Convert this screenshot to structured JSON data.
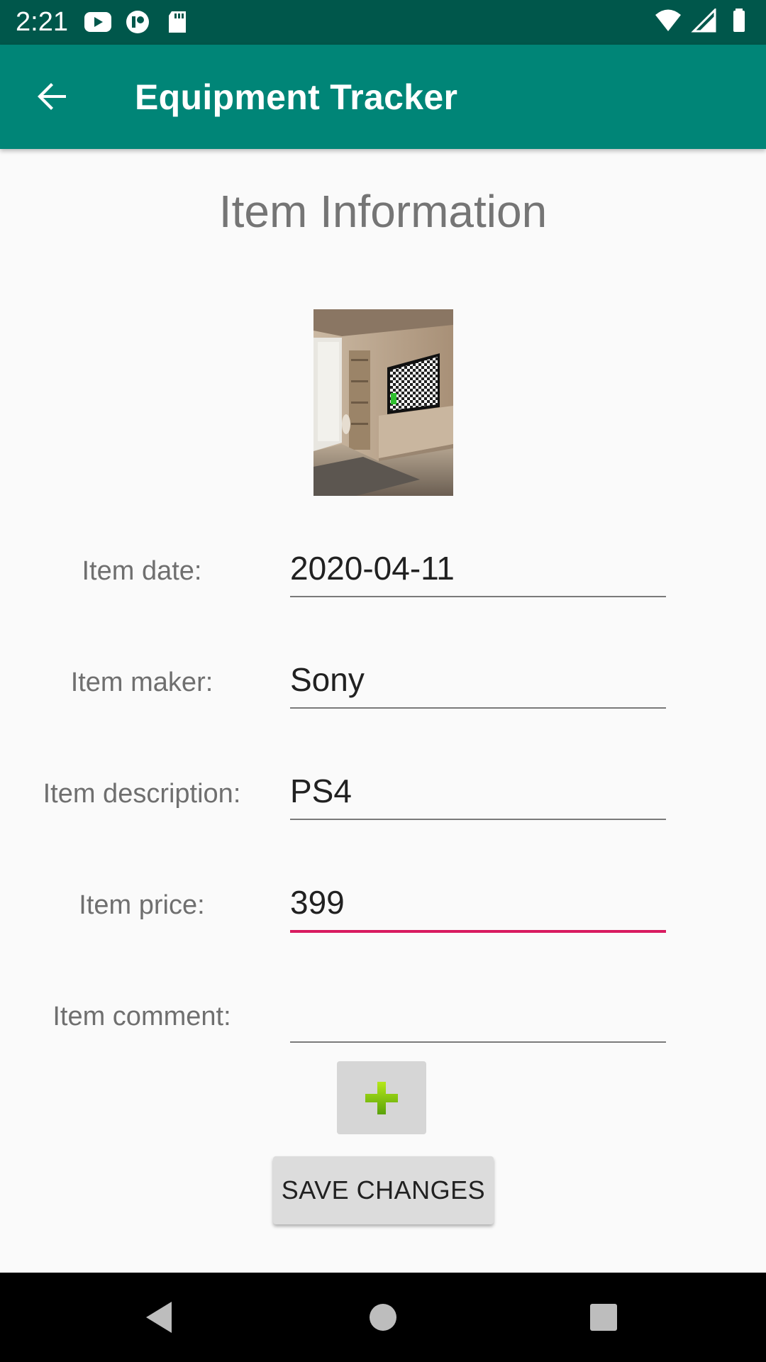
{
  "status_bar": {
    "time": "2:21",
    "left_icons": [
      "youtube-icon",
      "app-icon",
      "sd-card-icon"
    ],
    "right_icons": [
      "wifi-icon",
      "signal-icon",
      "battery-icon"
    ]
  },
  "app_bar": {
    "title": "Equipment Tracker",
    "background": "#008577",
    "status_bar_background": "#00574b"
  },
  "page": {
    "title": "Item Information"
  },
  "item_photo": {
    "description_icon": "item-photo"
  },
  "form": {
    "fields": [
      {
        "label": "Item date:",
        "value": "2020-04-11"
      },
      {
        "label": "Item maker:",
        "value": "Sony"
      },
      {
        "label": "Item description:",
        "value": "PS4"
      },
      {
        "label": "Item price:",
        "value": "399"
      },
      {
        "label": "Item comment:",
        "value": ""
      }
    ],
    "focused_field_index": 3,
    "accent_color": "#d81b60"
  },
  "actions": {
    "add_icon": "plus-icon",
    "save_label": "SAVE CHANGES"
  },
  "nav_bar": {
    "buttons": [
      "back-triangle-icon",
      "home-circle-icon",
      "recents-square-icon"
    ]
  }
}
